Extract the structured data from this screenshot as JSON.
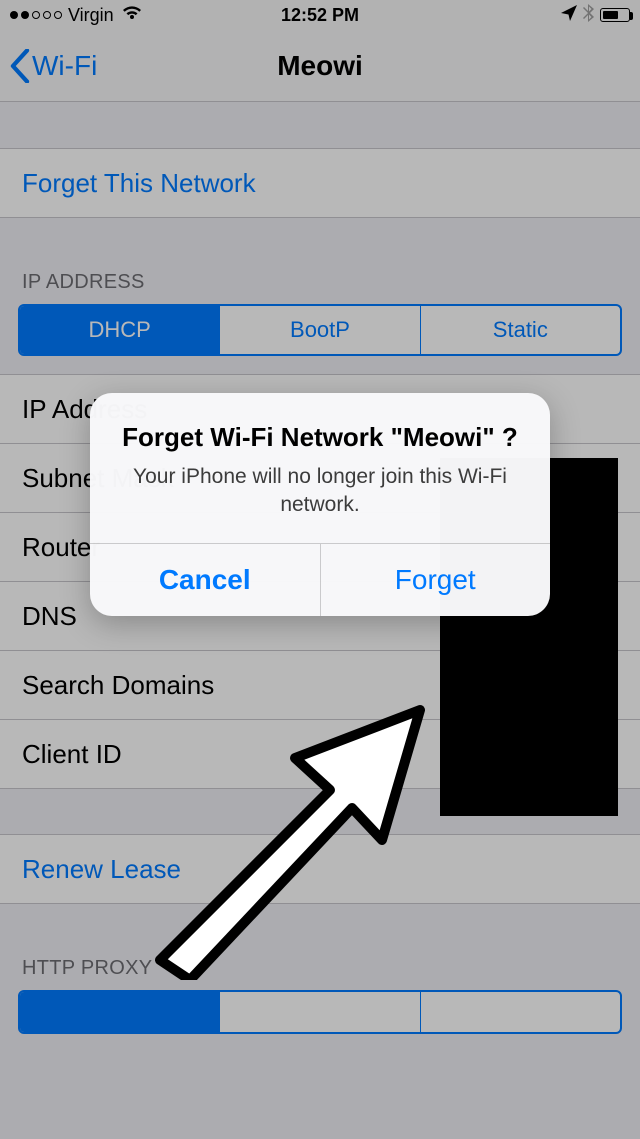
{
  "statusbar": {
    "carrier": "Virgin",
    "time": "12:52 PM",
    "battery_pct": 55
  },
  "nav": {
    "back_label": "Wi-Fi",
    "title": "Meowi"
  },
  "forget_row": {
    "label": "Forget This Network"
  },
  "sections": {
    "ip_header": "IP ADDRESS",
    "segments": {
      "dhcp": "DHCP",
      "bootp": "BootP",
      "static": "Static"
    },
    "rows": {
      "ip_address": "IP Address",
      "subnet_mask": "Subnet Mask",
      "router": "Router",
      "dns": "DNS",
      "search_domains": "Search Domains",
      "client_id": "Client ID"
    },
    "renew": "Renew Lease",
    "http_proxy_header": "HTTP PROXY"
  },
  "alert": {
    "title": "Forget Wi-Fi Network \"Meowi\" ?",
    "message": "Your iPhone will no longer join this Wi-Fi network.",
    "cancel": "Cancel",
    "confirm": "Forget"
  }
}
